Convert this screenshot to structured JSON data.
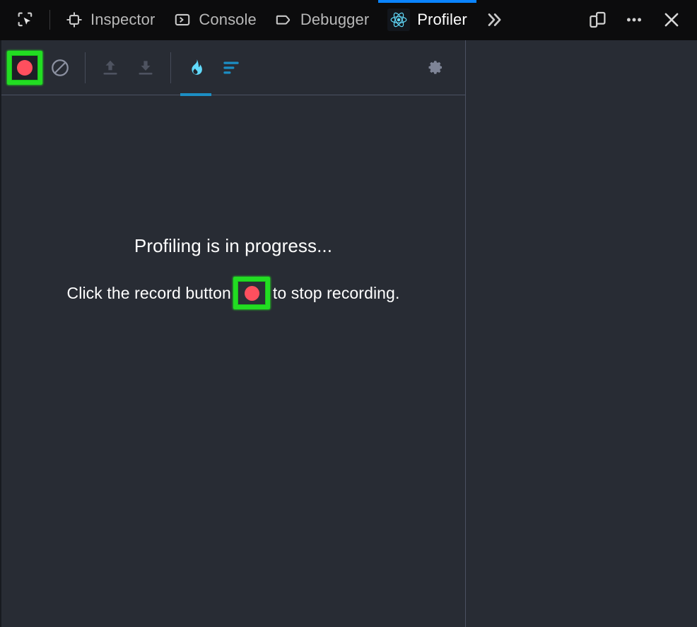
{
  "devtools_toolbar": {
    "picker": {
      "name": "element-picker-icon",
      "title": "Pick an element from the page"
    },
    "tabs": [
      {
        "id": "inspector",
        "label": "Inspector",
        "icon": "inspector-icon",
        "active": false
      },
      {
        "id": "console",
        "label": "Console",
        "icon": "console-icon",
        "active": false
      },
      {
        "id": "debugger",
        "label": "Debugger",
        "icon": "debugger-icon",
        "active": false
      },
      {
        "id": "profiler",
        "label": "Profiler",
        "icon": "react-logo-icon",
        "active": true
      }
    ],
    "overflow_label": "»",
    "responsive_mode": "responsive-design-mode-icon",
    "meatball_menu": "•••",
    "close_label": "✕",
    "accent_color": "#0a84ff"
  },
  "profiler_toolbar": {
    "record": {
      "label": "Start profiling",
      "icon": "record-icon",
      "highlighted": true,
      "dot_color": "#ff4f5e",
      "highlight_color": "#22dd22"
    },
    "clear": {
      "label": "Clear all profiling data",
      "icon": "clear-icon"
    },
    "load": {
      "label": "Load profile",
      "icon": "upload-icon",
      "disabled": true
    },
    "save": {
      "label": "Save profile",
      "icon": "download-icon",
      "disabled": true
    },
    "flamegraph": {
      "label": "Flamegraph chart",
      "icon": "flame-icon",
      "selected": true,
      "color": "#61dafb"
    },
    "ranked": {
      "label": "Ranked chart",
      "icon": "ranked-chart-icon",
      "color": "#1c8ec4"
    },
    "settings": {
      "label": "View settings",
      "icon": "gear-icon"
    },
    "tab_indicator_color": "#1c8ec4"
  },
  "empty_state": {
    "heading": "Profiling is in progress...",
    "subline_before": "Click the record button ",
    "subline_after": " to stop recording.",
    "inline_record_icon": "record-icon"
  }
}
